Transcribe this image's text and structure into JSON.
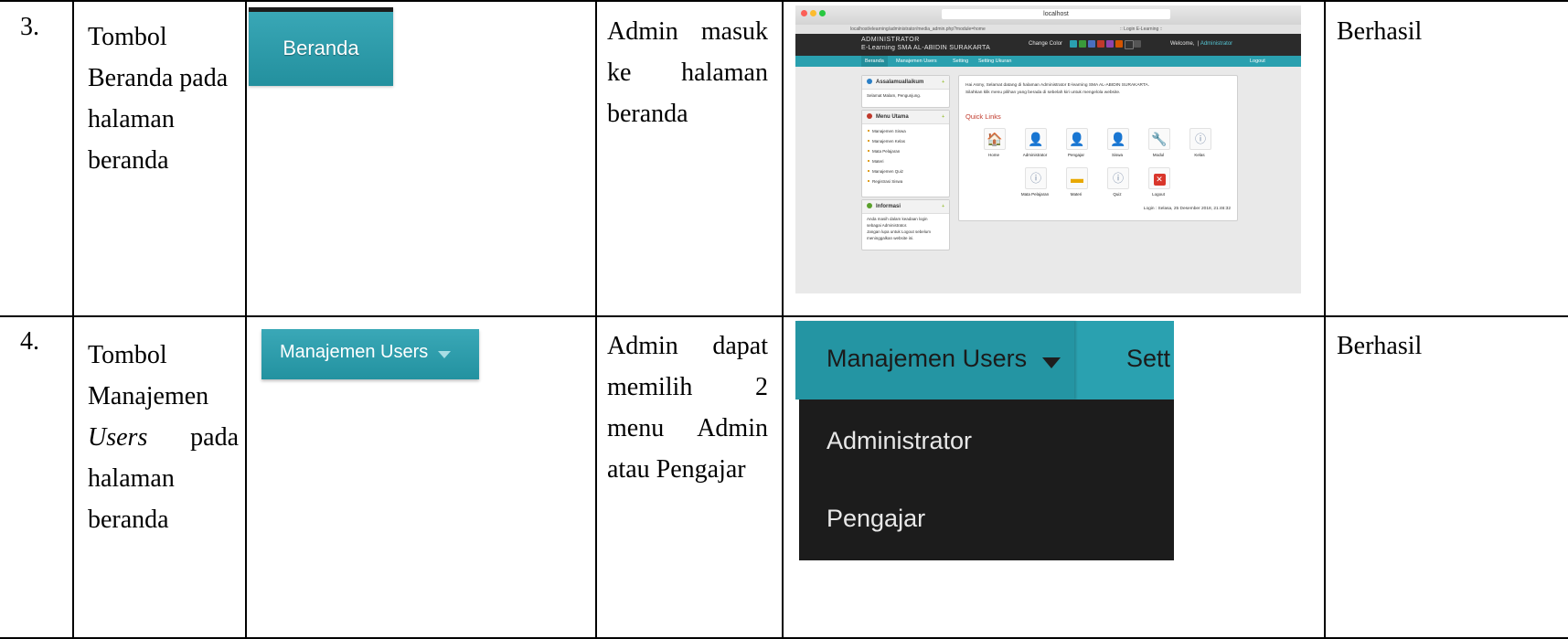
{
  "rows": [
    {
      "no": "3.",
      "name_lines": [
        "Tombol",
        "Beranda pada",
        "halaman",
        "beranda"
      ],
      "expected_lines": [
        "Admin masuk",
        "ke halaman",
        "beranda"
      ],
      "button_label": "Beranda",
      "result": "Berhasil"
    },
    {
      "no": "4.",
      "name_lines": [
        "Tombol",
        "Manajemen",
        "pada",
        "halaman",
        "beranda"
      ],
      "name_italic_word": "Users",
      "expected_lines": [
        "Admin dapat",
        "memilih 2",
        "menu Admin",
        "atau Pengajar"
      ],
      "button_label": "Manajemen Users",
      "result": "Berhasil",
      "dropdown": {
        "active_label": "Manajemen Users",
        "next_label_partial": "Sett",
        "items": [
          "Administrator",
          "Pengajar"
        ]
      }
    }
  ],
  "screenshot": {
    "url_bar": "localhost",
    "address": "localhost/elearning/administrator/media_admin.php?module=home",
    "tab_title": ":: Login E-Learning ::",
    "header_line1": "ADMINISTRATOR",
    "header_line2": "E-Learning SMA AL-ABIDIN SURAKARTA",
    "change_color": "Change Color",
    "welcome": "Welcome,",
    "welcome_user": "Administrator",
    "nav": [
      "Beranda",
      "Manajemen Users",
      "Setting",
      "Setting Ukuran"
    ],
    "logout": "Logout",
    "panel1_title": "Assalamuallaikum",
    "panel1_text": "Selamat Malam, Pengunjung.",
    "panel2_title": "Menu Utama",
    "panel2_items": [
      "Manajemen Siswa",
      "Manajemen Kelas",
      "Mata Pelajaran",
      "Materi",
      "Manajemen Quiz",
      "Registrasi Siswa"
    ],
    "panel3_title": "Informasi",
    "panel3_lines": [
      "Anda masih dalam keadaan login",
      "sebagai Administrator.",
      "Jangan lupa untuk Logout sebelum",
      "meninggalkan website ini."
    ],
    "greeting_line1": "Hai Asmy, Selamat datang di halaman Administrator E-learning SMA AL-ABIDIN SURAKARTA.",
    "greeting_line2": "Silahkan klik menu pilihan yang berada di sebelah kiri untuk mengelola website.",
    "quick_links_title": "Quick Links",
    "quick_links_row1": [
      "Home",
      "Administrator",
      "Pengajar",
      "Siswa",
      "Modul",
      "Kelas"
    ],
    "quick_links_row2": [
      "Mata Pelajaran",
      "Materi",
      "Quiz",
      "Logout"
    ],
    "login_info": "Login : Selasa, 25 Desember 2018, 21:46:32",
    "colors": {
      "teal": "#2aa0af",
      "dark_header": "#2b2b2b",
      "swatches": [
        "#2aa0af",
        "#3a9a3a",
        "#4a6fbf",
        "#c0392b",
        "#8e44ad",
        "#d35400",
        "#333333",
        "#555555"
      ]
    }
  },
  "icons": {
    "row1": [
      "house-icon",
      "user-icon",
      "user-icon",
      "user-icon",
      "wrench-icon",
      "info-icon"
    ],
    "row2": [
      "info-icon",
      "folder-icon",
      "info-icon",
      "close-icon"
    ]
  }
}
